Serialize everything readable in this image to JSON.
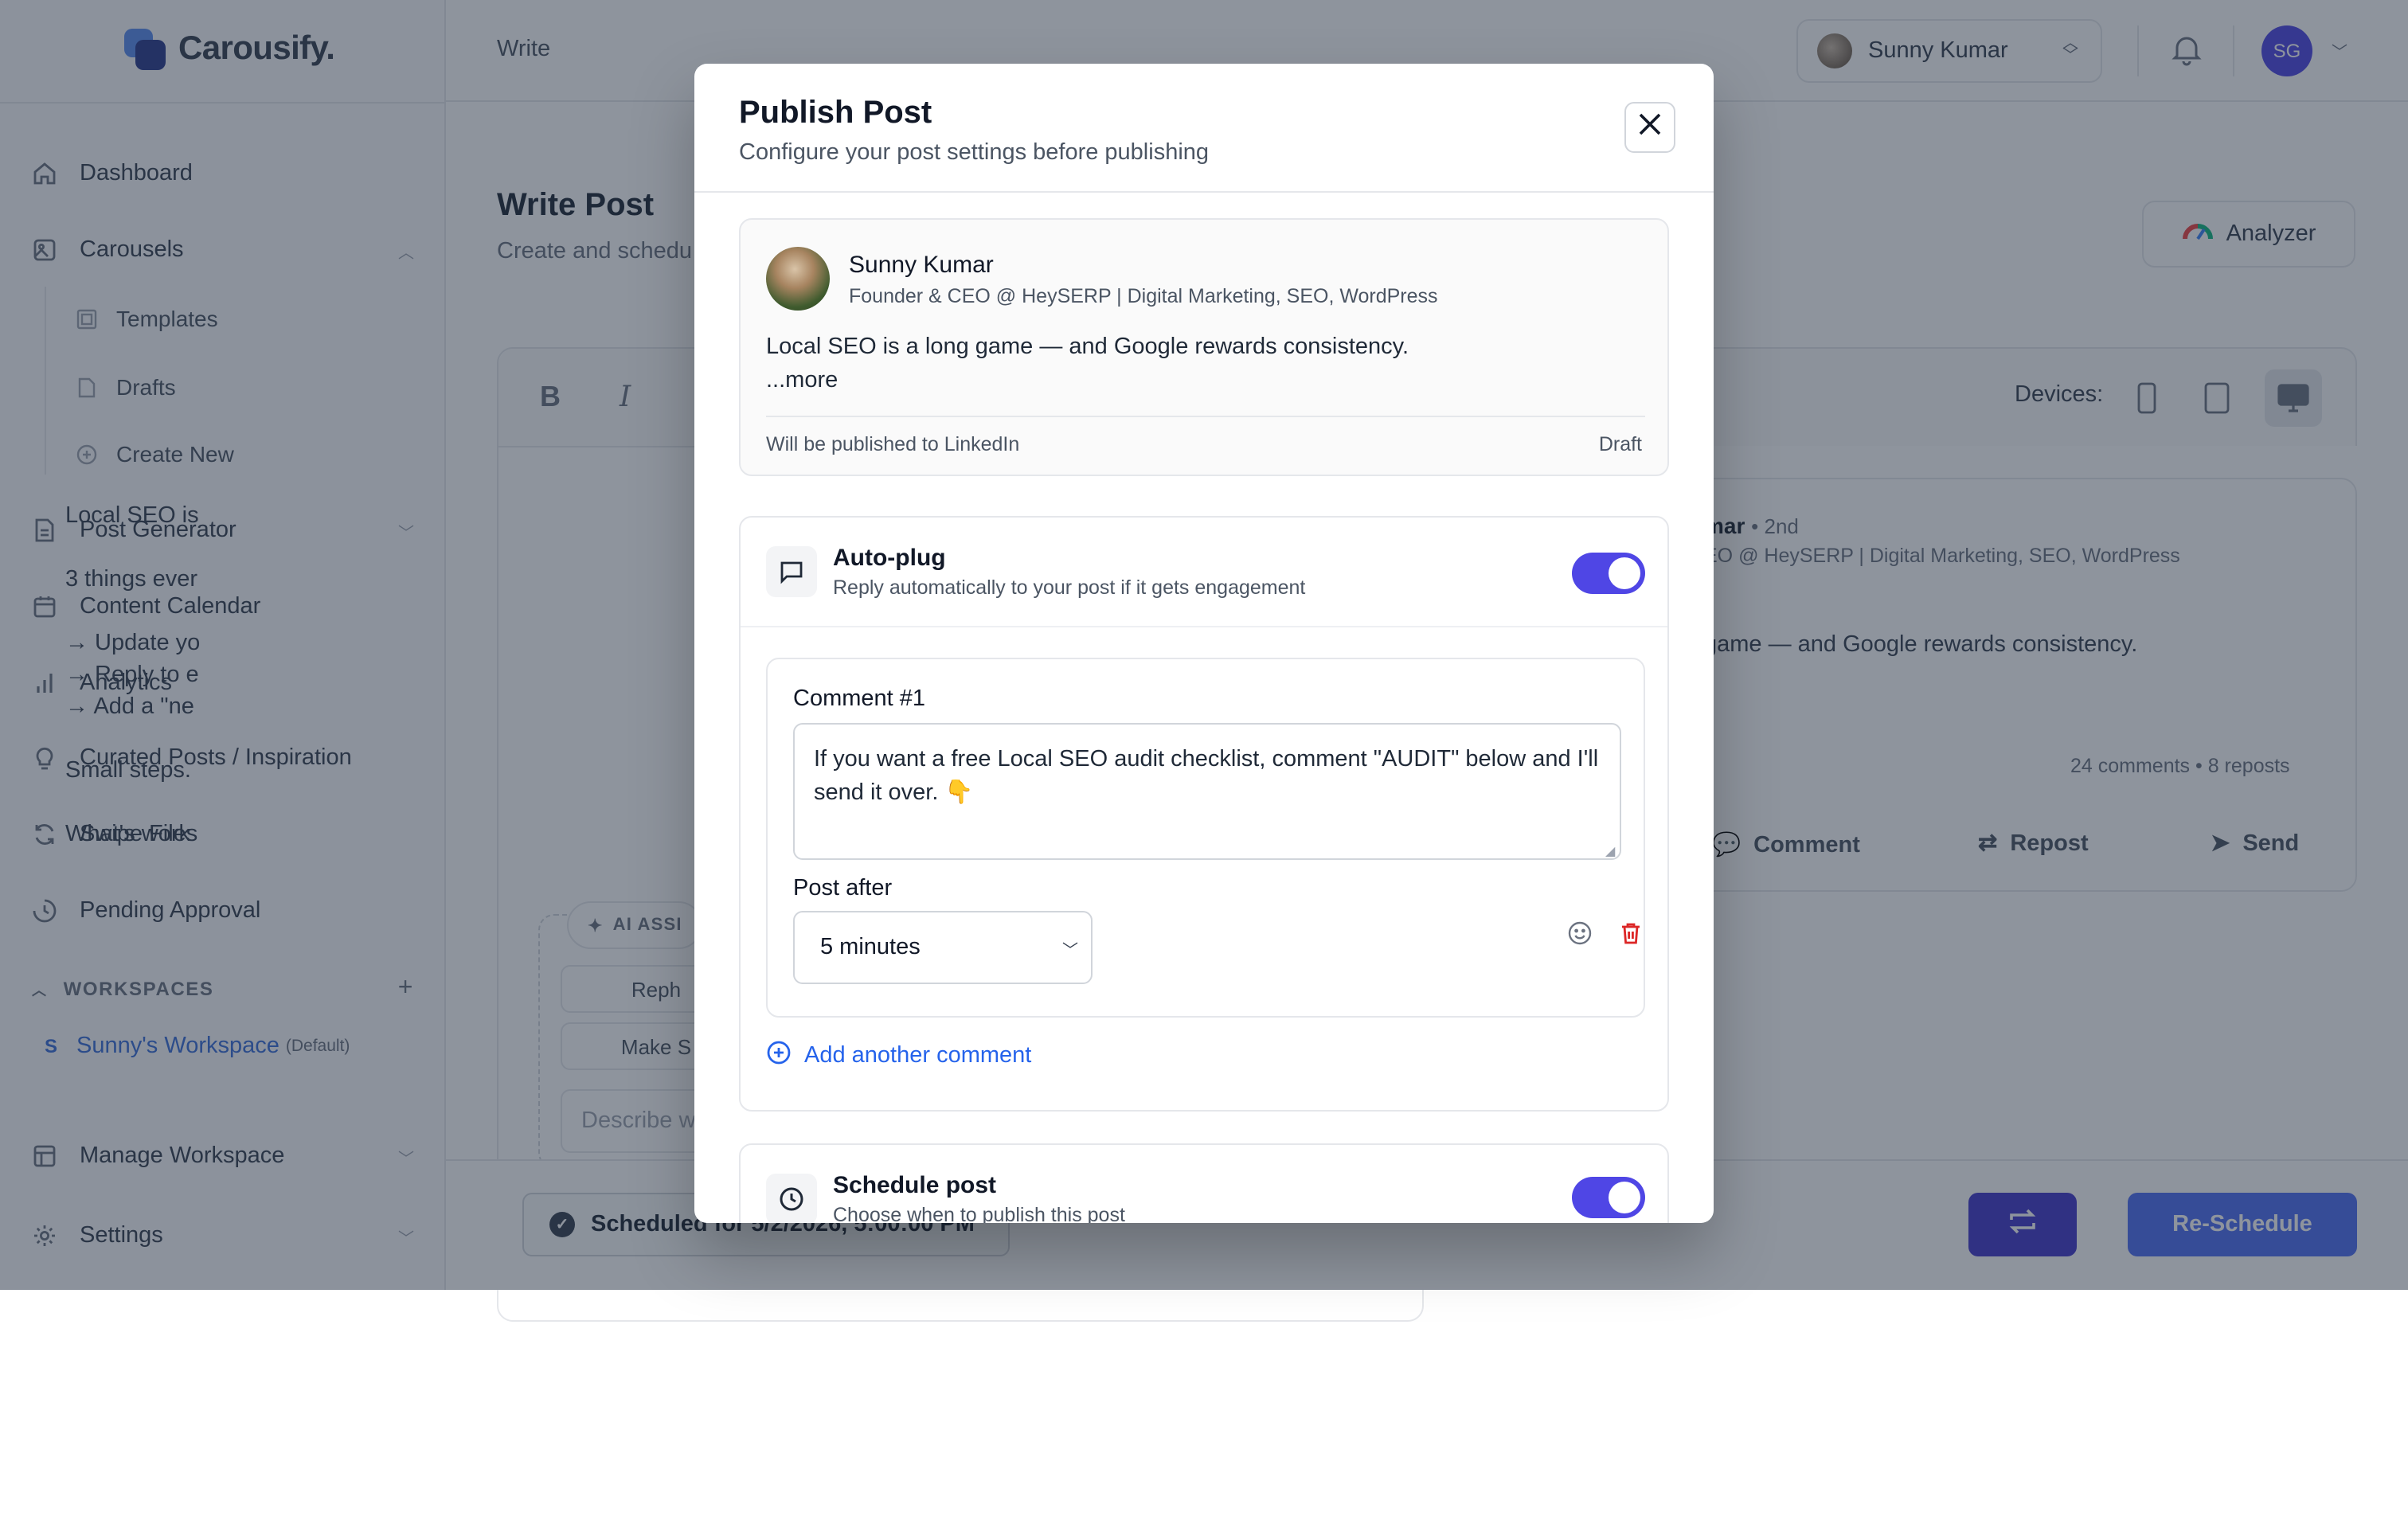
{
  "app": {
    "logo_text": "Carousify.",
    "breadcrumb": "Write",
    "account_name": "Sunny Kumar",
    "user_initials": "SG"
  },
  "sidebar": {
    "items": [
      {
        "label": "Dashboard",
        "icon": "home-icon"
      },
      {
        "label": "Carousels",
        "icon": "image-icon"
      },
      {
        "label": "Post Generator",
        "icon": "document-icon"
      },
      {
        "label": "Content Calendar",
        "icon": "calendar-icon"
      },
      {
        "label": "Analytics",
        "icon": "bar-chart-icon"
      },
      {
        "label": "Curated Posts / Inspiration",
        "icon": "lightbulb-icon"
      },
      {
        "label": "Swipe Files",
        "icon": "refresh-icon"
      },
      {
        "label": "Pending Approval",
        "icon": "pending-icon"
      },
      {
        "label": "Manage Workspace",
        "icon": "layout-icon"
      },
      {
        "label": "Settings",
        "icon": "gear-icon"
      }
    ],
    "carousel_sub": [
      {
        "label": "Templates",
        "icon": "template-icon"
      },
      {
        "label": "Drafts",
        "icon": "draft-icon"
      },
      {
        "label": "Create New",
        "icon": "plus-circle-icon"
      }
    ],
    "workspaces_heading": "WORKSPACES",
    "workspace": {
      "initial": "S",
      "name": "Sunny's Workspace",
      "tag": "(Default)"
    }
  },
  "main": {
    "title": "Write Post",
    "subtitle": "Create and schedu",
    "analyzer_label": "Analyzer",
    "toolbar": {
      "bold": "B",
      "italic": "I"
    },
    "editor_lines": [
      "Local SEO is",
      "3 things ever",
      "→ Update yo",
      "→ Reply to e",
      "→ Add a \"ne",
      "Small steps.",
      "What's work"
    ],
    "ai_assist_label": "AI ASSI",
    "ai_buttons": [
      "Reph",
      "Make S"
    ],
    "ai_input_placeholder": "Describe w",
    "devices_label": "Devices:",
    "preview": {
      "name": "mar",
      "degree": "• 2nd",
      "role": "EO @ HeySERP | Digital Marketing, SEO, WordPress",
      "text": "game — and Google rewards consistency.",
      "stats": "24 comments  •  8 reposts",
      "actions": [
        "Comment",
        "Repost",
        "Send"
      ]
    },
    "scheduled_label": "Scheduled for 5/2/2026, 5:00:00 PM",
    "reschedule_label": "Re-Schedule"
  },
  "modal": {
    "title": "Publish Post",
    "subtitle": "Configure your post settings before publishing",
    "post": {
      "author": "Sunny Kumar",
      "headline": "Founder & CEO @ HeySERP | Digital Marketing, SEO, WordPress",
      "text": "Local SEO is a long game — and Google rewards consistency.",
      "more": "...more",
      "destination": "Will be published to LinkedIn",
      "status": "Draft"
    },
    "autoplug": {
      "title": "Auto-plug",
      "subtitle": "Reply automatically to your post if it gets engagement",
      "enabled": true,
      "comment_label": "Comment #1",
      "comment_text": "If you want a free Local SEO audit checklist, comment \"AUDIT\" below and I'll send it over. 👇",
      "post_after_label": "Post after",
      "post_after_value": "5 minutes",
      "add_comment_label": "Add another comment"
    },
    "schedule": {
      "title": "Schedule post",
      "subtitle": "Choose when to publish this post",
      "enabled": true
    }
  },
  "colors": {
    "accent": "#4f46e5",
    "link": "#2563eb",
    "danger": "#dc2626",
    "overlay": "rgba(30,41,59,0.5)"
  }
}
